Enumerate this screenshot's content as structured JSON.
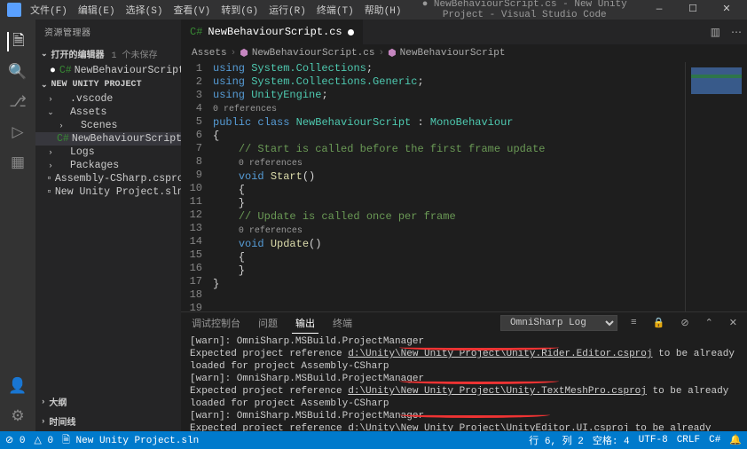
{
  "menu": [
    "文件(F)",
    "编辑(E)",
    "选择(S)",
    "查看(V)",
    "转到(G)",
    "运行(R)",
    "终端(T)",
    "帮助(H)"
  ],
  "window_title": "● NewBehaviourScript.cs - New Unity Project - Visual Studio Code",
  "sidebar": {
    "title": "资源管理器",
    "openEditors": "打开的编辑器",
    "unsaved": "1 个未保存",
    "project": "NEW UNITY PROJECT",
    "items": [
      {
        "name": ".vscode",
        "type": "folder",
        "indent": 1,
        "chev": "›"
      },
      {
        "name": "Assets",
        "type": "folder",
        "indent": 1,
        "chev": "⌄"
      },
      {
        "name": "Scenes",
        "type": "folder",
        "indent": 2,
        "chev": "›"
      },
      {
        "name": "NewBehaviourScript.cs",
        "type": "cs",
        "indent": 2,
        "active": true
      },
      {
        "name": "Logs",
        "type": "folder",
        "indent": 1,
        "chev": "›"
      },
      {
        "name": "Packages",
        "type": "folder",
        "indent": 1,
        "chev": "›"
      },
      {
        "name": "Assembly-CSharp.csproj",
        "type": "proj",
        "indent": 1
      },
      {
        "name": "New Unity Project.sln",
        "type": "sln",
        "indent": 1
      }
    ],
    "openFile": "NewBehaviourScript.cs",
    "openFilePath": "Assets",
    "outline": "大纲",
    "timeline": "时间线"
  },
  "tab": {
    "label": "NewBehaviourScript.cs"
  },
  "crumbs": [
    "Assets",
    "NewBehaviourScript.cs",
    "NewBehaviourScript"
  ],
  "code": {
    "l1": "using",
    "ns1": "System.Collections",
    "l2": "using",
    "ns2": "System.Collections.Generic",
    "l3": "using",
    "ns3": "UnityEngine",
    "ref": "0 references",
    "pub": "public",
    "cls": "class",
    "cname": "NewBehaviourScript",
    "base": "MonoBehaviour",
    "cm1": "// Start is called before the first frame update",
    "void": "void",
    "m1": "Start",
    "m2": "Update",
    "cm2": "// Update is called once per frame"
  },
  "panel": {
    "tabs": [
      "调试控制台",
      "问题",
      "输出",
      "终端"
    ],
    "active": 2,
    "select": "OmniSharp Log",
    "lines": [
      "[warn]: OmniSharp.MSBuild.ProjectManager",
      "        Expected project reference d:\\Unity\\New Unity Project\\Unity.Rider.Editor.csproj to be already loaded for project Assembly-CSharp",
      "[warn]: OmniSharp.MSBuild.ProjectManager",
      "        Expected project reference d:\\Unity\\New Unity Project\\Unity.TextMeshPro.csproj to be already loaded for project Assembly-CSharp",
      "[warn]: OmniSharp.MSBuild.ProjectManager",
      "        Expected project reference d:\\Unity\\New Unity Project\\UnityEditor.UI.csproj to be already loaded for project Assembly-CSharp"
    ]
  },
  "status": {
    "errors": "⊘ 0",
    "warnings": "△ 0",
    "sln": "New Unity Project.sln",
    "pos": "行 6, 列 2",
    "spaces": "空格: 4",
    "enc": "UTF-8",
    "eol": "CRLF",
    "lang": "C#",
    "bell": "🔔"
  }
}
